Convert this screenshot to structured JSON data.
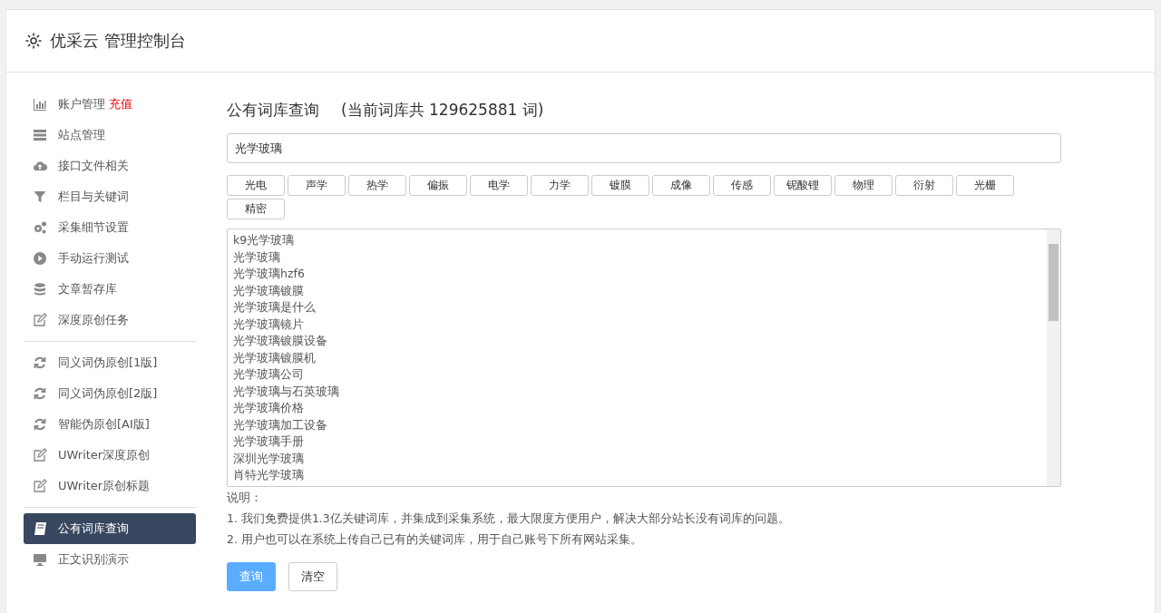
{
  "header": {
    "title": "优采云 管理控制台"
  },
  "sidebar": {
    "groups": [
      [
        {
          "label": "账户管理",
          "badge": "充值",
          "kind": "chart",
          "selected": false
        },
        {
          "label": "站点管理",
          "kind": "server",
          "selected": false
        },
        {
          "label": "接口文件相关",
          "kind": "cloud",
          "selected": false
        },
        {
          "label": "栏目与关键词",
          "kind": "filter",
          "selected": false
        },
        {
          "label": "采集细节设置",
          "kind": "gears",
          "selected": false
        },
        {
          "label": "手动运行测试",
          "kind": "play",
          "selected": false
        },
        {
          "label": "文章暂存库",
          "kind": "database",
          "selected": false
        },
        {
          "label": "深度原创任务",
          "kind": "edit",
          "selected": false
        }
      ],
      [
        {
          "label": "同义词伪原创[1版]",
          "kind": "refresh",
          "selected": false
        },
        {
          "label": "同义词伪原创[2版]",
          "kind": "refresh",
          "selected": false
        },
        {
          "label": "智能伪原创[AI版]",
          "kind": "refresh",
          "selected": false
        },
        {
          "label": "UWriter深度原创",
          "kind": "edit",
          "selected": false
        },
        {
          "label": "UWriter原创标题",
          "kind": "edit",
          "selected": false
        }
      ],
      [
        {
          "label": "公有词库查询",
          "kind": "book",
          "selected": true
        },
        {
          "label": "正文识别演示",
          "kind": "monitor",
          "selected": false
        }
      ]
    ]
  },
  "main": {
    "heading": "公有词库查询",
    "count": "(当前词库共 129625881 词)",
    "search": {
      "value": "光学玻璃"
    },
    "tags": [
      "光电",
      "声学",
      "热学",
      "偏振",
      "电学",
      "力学",
      "镀膜",
      "成像",
      "传感",
      "铌酸锂",
      "物理",
      "衍射",
      "光栅",
      "精密"
    ],
    "results": [
      "k9光学玻璃",
      "光学玻璃",
      "光学玻璃hzf6",
      "光学玻璃镀膜",
      "光学玻璃是什么",
      "光学玻璃镜片",
      "光学玻璃镀膜设备",
      "光学玻璃镀膜机",
      "光学玻璃公司",
      "光学玻璃与石英玻璃",
      "光学玻璃价格",
      "光学玻璃加工设备",
      "光学玻璃手册",
      "深圳光学玻璃",
      "肖特光学玻璃"
    ],
    "notes": {
      "label": "说明：",
      "lines": [
        "1. 我们免费提供1.3亿关键词库，并集成到采集系统，最大限度方便用户，解决大部分站长没有词库的问题。",
        "2. 用户也可以在系统上传自己已有的关键词库，用于自己账号下所有网站采集。"
      ]
    },
    "buttons": [
      {
        "label": "查询",
        "kind": "primary"
      },
      {
        "label": "清空",
        "kind": "default"
      }
    ]
  }
}
